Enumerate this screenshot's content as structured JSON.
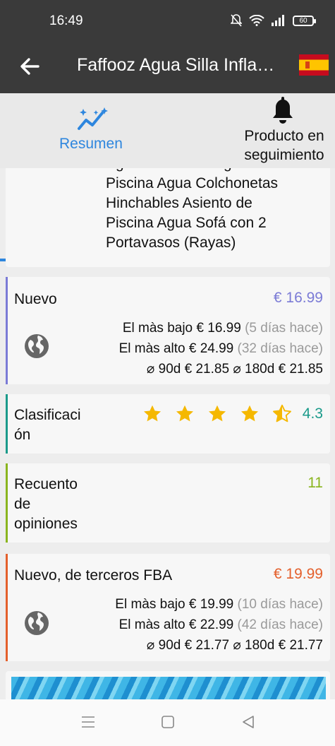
{
  "status": {
    "time": "16:49",
    "battery": "60"
  },
  "appbar": {
    "title": "Faffooz Agua Silla Infla…"
  },
  "tabs": [
    {
      "label": "Resumen",
      "icon": "trend-icon"
    },
    {
      "label": "Producto en seguimiento",
      "icon": "bell-icon"
    }
  ],
  "product": {
    "title_lines": [
      "Agua Flotante Plegable de la",
      "Piscina Agua Colchonetas",
      "Hinchables Asiento de",
      "Piscina Agua Sofá con 2",
      "Portavasos (Rayas)"
    ]
  },
  "nuevo": {
    "label": "Nuevo",
    "price": "€ 16.99",
    "lowest_label": "El màs bajo",
    "lowest_price": "€ 16.99",
    "lowest_ago": "(5 días hace)",
    "highest_label": "El màs alto",
    "highest_price": "€ 24.99",
    "highest_ago": "(32 días hace)",
    "avg90_label": "⌀ 90d",
    "avg90": "€ 21.85",
    "avg180_label": "⌀ 180d",
    "avg180": "€ 21.85",
    "color": "#7b7bd6"
  },
  "clasificacion": {
    "label_lines": [
      "Clasificaci",
      "ón"
    ],
    "value": "4.3",
    "rating": 4.3,
    "color": "#1a9a8a"
  },
  "recuento": {
    "label_lines": [
      "Recuento",
      "de",
      "opiniones"
    ],
    "value": "11",
    "color": "#8ab51e"
  },
  "fba": {
    "label": "Nuevo, de terceros FBA",
    "price": "€ 19.99",
    "lowest_label": "El màs bajo",
    "lowest_price": "€ 19.99",
    "lowest_ago": "(10 días hace)",
    "highest_label": "El màs alto",
    "highest_price": "€ 22.99",
    "highest_ago": "(42 días hace)",
    "avg90_label": "⌀ 90d",
    "avg90": "€ 21.77",
    "avg180_label": "⌀ 180d",
    "avg180": "€ 21.77",
    "color": "#e4602c"
  },
  "colors": {
    "accent": "#2e86de",
    "star": "#f5b800",
    "header": "#3a3a3a"
  }
}
